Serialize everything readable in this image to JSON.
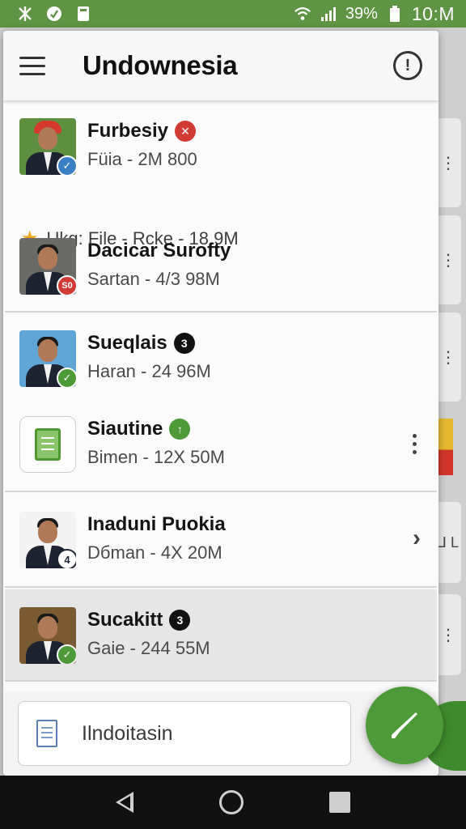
{
  "status_bar": {
    "battery": "39%",
    "time": "10:M"
  },
  "header": {
    "title": "Undownesia"
  },
  "background_screen": {
    "row_glyph": "ᒧ L"
  },
  "items": [
    {
      "name": "Furbesiy",
      "meta": "Füia - 2M 800",
      "badge": "✓",
      "badge_color": "#3a7fc4",
      "status": "✕",
      "status_color": "#d23a34",
      "avatar_bg": "#5e8f41",
      "avatar_cap": "#d43a2e"
    },
    {
      "name": "Dacicar Surofty",
      "meta": "Sartan - 4/3 98M",
      "badge": "S0",
      "badge_color": "#d23a34",
      "avatar_bg": "#6a6a66"
    },
    {
      "name": "Sueqlais",
      "meta": "Haran - 24 96M",
      "badge": "✓",
      "badge_color": "#4e9a38",
      "status": "3",
      "status_color": "#111111",
      "avatar_bg": "#5fa5d6"
    },
    {
      "name": "Siautine",
      "meta": "Bimen - 12X 50M",
      "status": "↑",
      "status_color": "#4e9a38"
    },
    {
      "name": "Inaduni Puokia",
      "meta": "Dбman - 4X 20M",
      "badge": "4",
      "badge_color": "#ffffff",
      "avatar_bg": "#f3f3f3"
    },
    {
      "name": "Sucakitt",
      "meta": "Gaie - 244 55M",
      "badge": "✓",
      "badge_color": "#4e9a38",
      "status": "3",
      "status_color": "#111111",
      "avatar_bg": "#7a5a32"
    }
  ],
  "shared_file": {
    "label": "Ukg: File - Rcke - 18.9M",
    "icon": "star-icon",
    "color": "#f0a818"
  },
  "compose": {
    "text": "Ilndoitasin"
  },
  "fab": {
    "icon": "pen-icon",
    "color": "#4e9a38"
  }
}
